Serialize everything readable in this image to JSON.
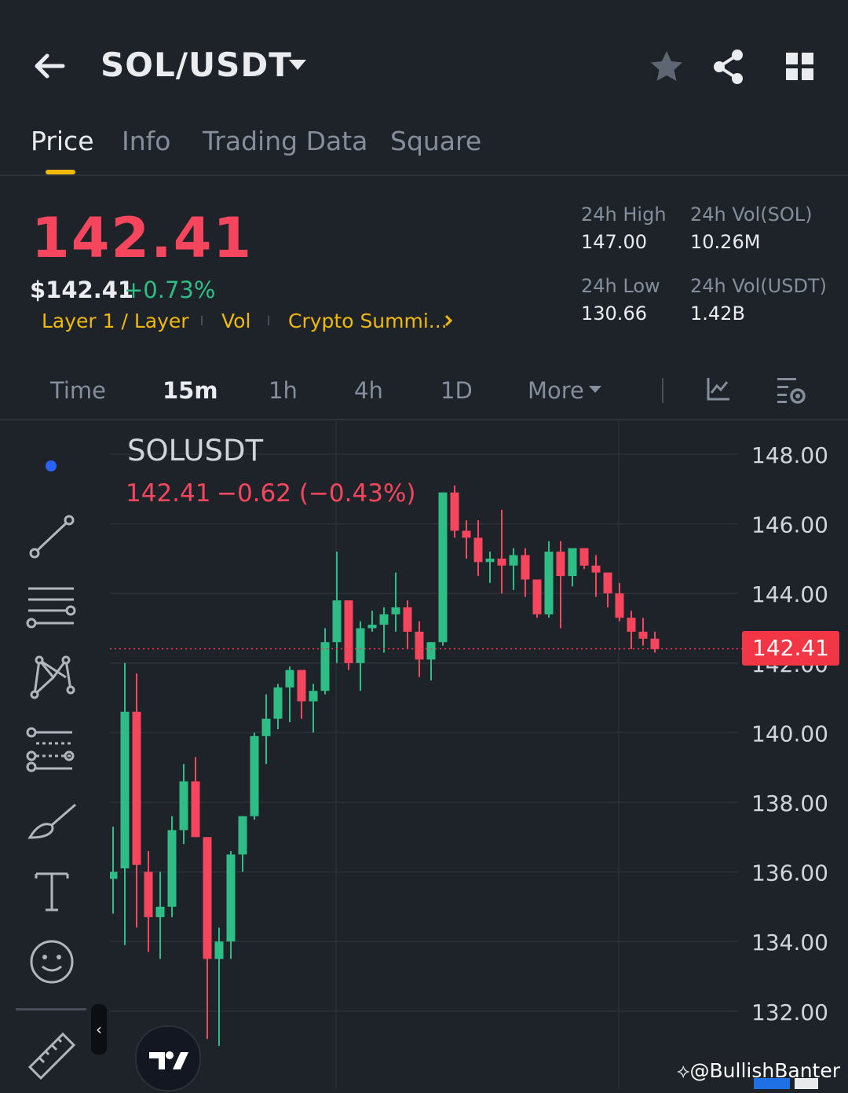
{
  "header": {
    "pair": "SOL/USDT"
  },
  "tabs": [
    {
      "label": "Price",
      "active": true
    },
    {
      "label": "Info",
      "active": false
    },
    {
      "label": "Trading Data",
      "active": false
    },
    {
      "label": "Square",
      "active": false
    }
  ],
  "price": {
    "last": "142.41",
    "usd": "$142.41",
    "change_pct": "+0.73%",
    "tags": [
      "Layer 1 / Layer",
      "Vol",
      "Crypto Summi..."
    ]
  },
  "stats": {
    "high_label": "24h High",
    "high_value": "147.00",
    "low_label": "24h Low",
    "low_value": "130.66",
    "vol_base_label": "24h Vol(SOL)",
    "vol_base_value": "10.26M",
    "vol_quote_label": "24h Vol(USDT)",
    "vol_quote_value": "1.42B"
  },
  "intervals": [
    {
      "label": "Time",
      "active": false
    },
    {
      "label": "15m",
      "active": true
    },
    {
      "label": "1h",
      "active": false
    },
    {
      "label": "4h",
      "active": false
    },
    {
      "label": "1D",
      "active": false
    },
    {
      "label": "More",
      "active": false
    }
  ],
  "chart_header": {
    "symbol": "SOLUSDT",
    "price": "142.41",
    "change": "−0.62 (−0.43%)"
  },
  "colors": {
    "up": "#2ebd85",
    "down": "#f6465d",
    "accent": "#f0b90b",
    "background": "#1e2329"
  },
  "icons": [
    "back-arrow-icon",
    "star-icon",
    "share-icon",
    "grid-icon",
    "indicator-icon",
    "chart-settings-icon",
    "trend-line-icon",
    "horizontal-lines-icon",
    "pattern-icon",
    "fib-icon",
    "brush-icon",
    "text-icon",
    "emoji-icon",
    "ruler-icon"
  ],
  "watermark": "@BullishBanter",
  "chart_data": {
    "type": "candlestick",
    "ylim": [
      131,
      148.6
    ],
    "yticks": [
      "148.00",
      "146.00",
      "144.00",
      "142.00",
      "140.00",
      "138.00",
      "136.00",
      "134.00",
      "132.00"
    ],
    "last_price": "142.41",
    "candles": [
      {
        "o": 135.8,
        "h": 137.3,
        "l": 134.8,
        "c": 136.0
      },
      {
        "o": 136.1,
        "h": 142.0,
        "l": 133.9,
        "c": 140.6
      },
      {
        "o": 140.6,
        "h": 141.7,
        "l": 134.4,
        "c": 136.2
      },
      {
        "o": 136.0,
        "h": 136.6,
        "l": 133.7,
        "c": 134.7
      },
      {
        "o": 134.7,
        "h": 136.0,
        "l": 133.5,
        "c": 135.0
      },
      {
        "o": 135.0,
        "h": 137.6,
        "l": 134.7,
        "c": 137.2
      },
      {
        "o": 137.2,
        "h": 139.1,
        "l": 136.8,
        "c": 138.6
      },
      {
        "o": 138.6,
        "h": 139.3,
        "l": 137.0,
        "c": 137.0
      },
      {
        "o": 137.0,
        "h": 137.0,
        "l": 131.2,
        "c": 133.5
      },
      {
        "o": 133.5,
        "h": 134.4,
        "l": 131.0,
        "c": 134.0
      },
      {
        "o": 134.0,
        "h": 136.6,
        "l": 133.5,
        "c": 136.5
      },
      {
        "o": 136.5,
        "h": 137.6,
        "l": 136.0,
        "c": 137.6
      },
      {
        "o": 137.6,
        "h": 140.0,
        "l": 137.5,
        "c": 139.9
      },
      {
        "o": 139.9,
        "h": 141.1,
        "l": 139.1,
        "c": 140.4
      },
      {
        "o": 140.4,
        "h": 141.4,
        "l": 140.1,
        "c": 141.3
      },
      {
        "o": 141.3,
        "h": 141.9,
        "l": 140.3,
        "c": 141.8
      },
      {
        "o": 141.8,
        "h": 141.8,
        "l": 140.4,
        "c": 140.9
      },
      {
        "o": 140.9,
        "h": 141.4,
        "l": 140.0,
        "c": 141.2
      },
      {
        "o": 141.2,
        "h": 143.0,
        "l": 141.1,
        "c": 142.6
      },
      {
        "o": 142.6,
        "h": 145.2,
        "l": 142.0,
        "c": 143.8
      },
      {
        "o": 143.8,
        "h": 143.8,
        "l": 141.8,
        "c": 142.0
      },
      {
        "o": 142.0,
        "h": 143.2,
        "l": 141.2,
        "c": 143.0
      },
      {
        "o": 143.0,
        "h": 143.5,
        "l": 142.9,
        "c": 143.1
      },
      {
        "o": 143.1,
        "h": 143.6,
        "l": 142.3,
        "c": 143.4
      },
      {
        "o": 143.4,
        "h": 144.6,
        "l": 142.9,
        "c": 143.6
      },
      {
        "o": 143.6,
        "h": 143.8,
        "l": 142.4,
        "c": 142.9
      },
      {
        "o": 142.9,
        "h": 143.2,
        "l": 141.6,
        "c": 142.1
      },
      {
        "o": 142.1,
        "h": 142.6,
        "l": 141.5,
        "c": 142.6
      },
      {
        "o": 142.6,
        "h": 146.9,
        "l": 142.5,
        "c": 146.9
      },
      {
        "o": 146.9,
        "h": 147.1,
        "l": 145.6,
        "c": 145.8
      },
      {
        "o": 145.8,
        "h": 146.1,
        "l": 145.0,
        "c": 145.6
      },
      {
        "o": 145.6,
        "h": 146.1,
        "l": 144.5,
        "c": 144.9
      },
      {
        "o": 144.9,
        "h": 145.2,
        "l": 144.3,
        "c": 145.0
      },
      {
        "o": 145.0,
        "h": 146.4,
        "l": 144.0,
        "c": 144.8
      },
      {
        "o": 144.8,
        "h": 145.3,
        "l": 144.1,
        "c": 145.1
      },
      {
        "o": 145.1,
        "h": 145.3,
        "l": 143.9,
        "c": 144.4
      },
      {
        "o": 144.4,
        "h": 144.4,
        "l": 143.3,
        "c": 143.4
      },
      {
        "o": 143.4,
        "h": 145.5,
        "l": 143.3,
        "c": 145.2
      },
      {
        "o": 145.2,
        "h": 145.5,
        "l": 143.0,
        "c": 144.5
      },
      {
        "o": 144.5,
        "h": 145.2,
        "l": 144.2,
        "c": 145.3
      },
      {
        "o": 145.3,
        "h": 145.3,
        "l": 144.7,
        "c": 144.8
      },
      {
        "o": 144.8,
        "h": 145.1,
        "l": 143.9,
        "c": 144.6
      },
      {
        "o": 144.6,
        "h": 144.6,
        "l": 143.6,
        "c": 144.0
      },
      {
        "o": 144.0,
        "h": 144.3,
        "l": 143.2,
        "c": 143.3
      },
      {
        "o": 143.3,
        "h": 143.5,
        "l": 142.4,
        "c": 142.9
      },
      {
        "o": 142.9,
        "h": 143.3,
        "l": 142.5,
        "c": 142.7
      },
      {
        "o": 142.7,
        "h": 142.9,
        "l": 142.3,
        "c": 142.4
      }
    ]
  }
}
